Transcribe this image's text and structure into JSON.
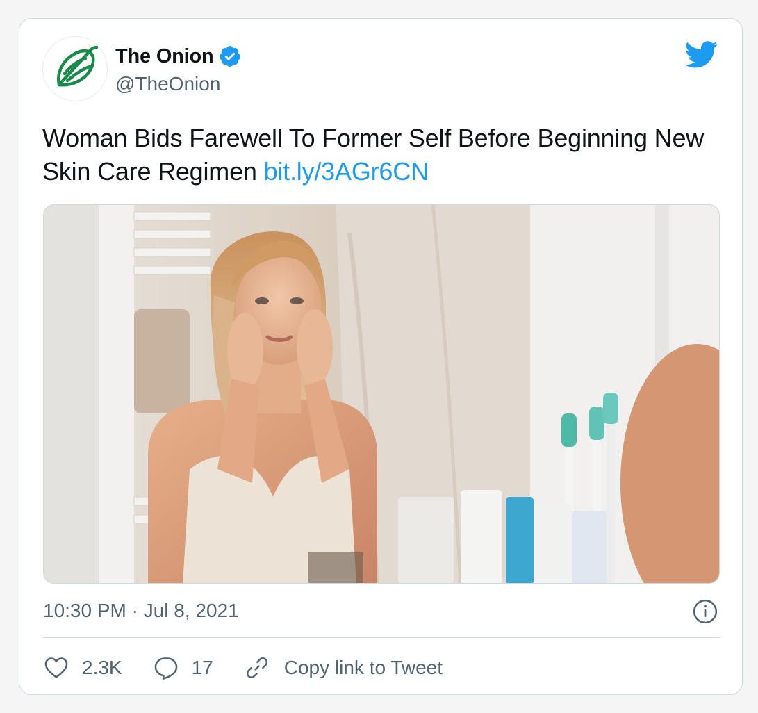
{
  "tweet": {
    "author": {
      "display_name": "The Onion",
      "handle": "@TheOnion",
      "verified": true,
      "avatar_icon": "onion-logo-icon"
    },
    "text": "Woman Bids Farewell To Former Self Before Beginning New Skin Care Regimen",
    "link": "bit.ly/3AGr6CN",
    "media": {
      "type": "photo"
    },
    "timestamp": "10:30 PM · Jul 8, 2021",
    "actions": {
      "likes": "2.3K",
      "replies": "17",
      "copy_link_label": "Copy link to Tweet"
    }
  },
  "colors": {
    "link": "#1d9bf0",
    "secondary_text": "#536471",
    "brand_green": "#1a8a4a",
    "twitter_blue": "#1d9bf0",
    "border": "#cfd9de"
  },
  "icons": {
    "verified": "verified-badge-icon",
    "brand": "twitter-bird-icon",
    "info": "info-icon",
    "like": "heart-icon",
    "reply": "reply-bubble-icon",
    "copy_link": "link-icon"
  }
}
